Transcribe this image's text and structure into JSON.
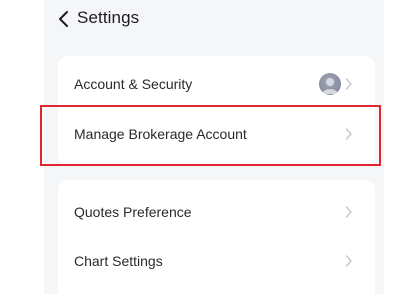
{
  "header": {
    "title": "Settings"
  },
  "groups": [
    {
      "items": [
        {
          "label": "Account & Security",
          "trailing": "avatar"
        },
        {
          "label": "Manage Brokerage Account",
          "trailing": "chevron"
        }
      ]
    },
    {
      "items": [
        {
          "label": "Quotes Preference",
          "trailing": "chevron"
        },
        {
          "label": "Chart Settings",
          "trailing": "chevron"
        }
      ]
    }
  ],
  "icons": {
    "back": "chevron-left-icon",
    "row_arrow": "chevron-right-icon",
    "avatar": "user-avatar"
  },
  "colors": {
    "page_background": "#f5f6f8",
    "card_background": "#ffffff",
    "text_primary": "#2a2a2e",
    "chevron": "#c4c6cc",
    "highlight_border": "#e0262f"
  }
}
